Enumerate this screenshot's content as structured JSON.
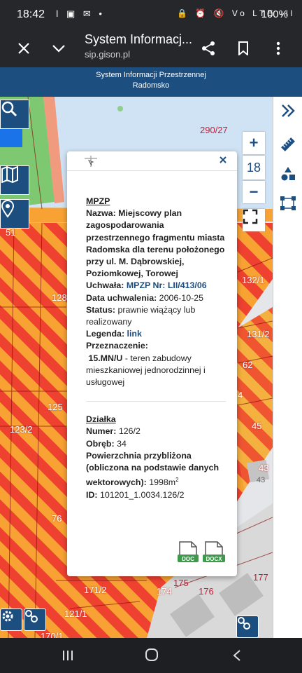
{
  "status": {
    "time": "18:42",
    "left_icons": "ǀ ▣ ✉ •",
    "right_icons": "🔒 ⏰ 🔇 Vo LTE ıll",
    "battery": "100%"
  },
  "tab": {
    "title": "System Informacj...",
    "url": "sip.gison.pl"
  },
  "app": {
    "title_line1": "System Informacji Przestrzennej",
    "title_line2": "Radomsko"
  },
  "map": {
    "zoom_level": "18",
    "zoom_in": "+",
    "zoom_out": "−",
    "labels": {
      "l1": "290/27",
      "l2": "51",
      "l3": "132/1",
      "l4": "128",
      "l5": "131/2",
      "l6": "62",
      "l7": "125",
      "l8": "123/2",
      "l9": "45",
      "l10": "43",
      "l11": "43",
      "l12": "76",
      "l13": "171/2",
      "l14": "175",
      "l15": "174",
      "l16": "176",
      "l17": "177",
      "l18": "121/1",
      "l19": "170/1",
      "l20": "4"
    }
  },
  "popup": {
    "mpzp_heading": "MPZP",
    "nazwa_label": "Nazwa:",
    "nazwa_value": "Miejscowy plan zagospodarowania przestrzennego fragmentu miasta Radomska dla terenu położonego przy ul. M. Dąbrowskiej, Poziomkowej, Torowej",
    "uchwala_label": "Uchwała:",
    "uchwala_value": "MPZP Nr: LII/413/06",
    "data_label": "Data uchwalenia:",
    "data_value": "2006-10-25",
    "status_label": "Status:",
    "status_value": "prawnie wiążący lub realizowany",
    "legenda_label": "Legenda:",
    "legenda_value": "link",
    "przeznaczenie_label": "Przeznaczenie:",
    "przeznaczenie_code": "15.MN/U",
    "przeznaczenie_value": "- teren zabudowy mieszkaniowej jednorodzinnej i usługowej",
    "dzialka_heading": "Działka",
    "numer_label": "Numer:",
    "numer_value": "126/2",
    "obreb_label": "Obręb:",
    "obreb_value": "34",
    "pow_label": "Powierzchnia przybliżona (obliczona na podstawie danych wektorowych):",
    "pow_value": "1998m",
    "pow_sup": "2",
    "id_label": "ID:",
    "id_value": "101201_1.0034.126/2",
    "doc_label": "DOC",
    "docx_label": "DOCX"
  },
  "colors": {
    "accent": "#1d4e80",
    "hatch_orange": "#f7a233",
    "hatch_red": "#ef4130"
  }
}
